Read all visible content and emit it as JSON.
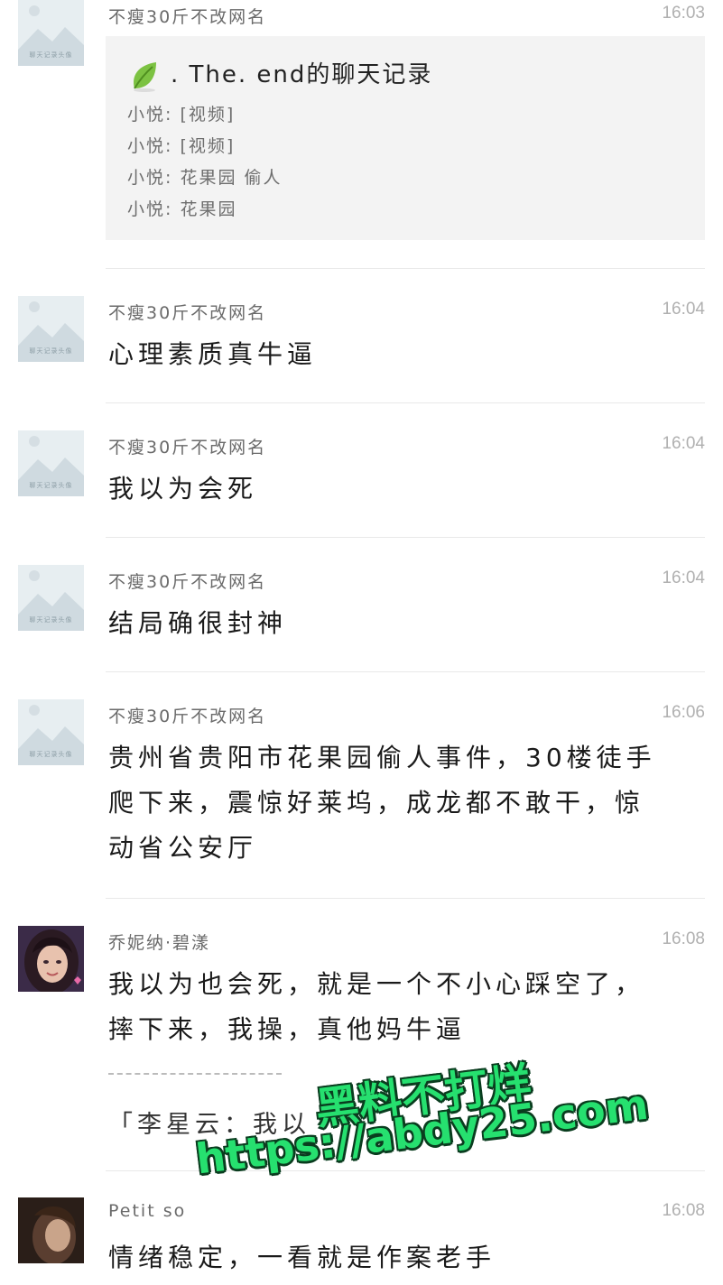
{
  "messages": [
    {
      "sender": "不瘦30斤不改网名",
      "time": "16:03",
      "avatar_caption": "聊天记录头像",
      "card": {
        "title": ". The. end的聊天记录",
        "lines": [
          "小悦: [视频]",
          "小悦: [视频]",
          "小悦: 花果园 偷人",
          "小悦: 花果园"
        ]
      }
    },
    {
      "sender": "不瘦30斤不改网名",
      "time": "16:04",
      "avatar_caption": "聊天记录头像",
      "text": "心理素质真牛逼"
    },
    {
      "sender": "不瘦30斤不改网名",
      "time": "16:04",
      "avatar_caption": "聊天记录头像",
      "text": "我以为会死"
    },
    {
      "sender": "不瘦30斤不改网名",
      "time": "16:04",
      "avatar_caption": "聊天记录头像",
      "text": "结局确很封神"
    },
    {
      "sender": "不瘦30斤不改网名",
      "time": "16:06",
      "avatar_caption": "聊天记录头像",
      "lines": [
        "贵州省贵阳市花果园偷人事件，30楼徒手",
        "爬下来，震惊好莱坞，成龙都不敢干，惊",
        "动省公安厅"
      ]
    },
    {
      "sender": "乔妮纳·碧漾",
      "time": "16:08",
      "lines": [
        "我以为也会死，就是一个不小心踩空了，",
        "摔下来，我操，真他妈牛逼"
      ],
      "quote": "「李星云：我以"
    },
    {
      "sender": "Petit so",
      "time": "16:08",
      "text": "情绪稳定，一看就是作案老手"
    }
  ],
  "watermark": {
    "line1": "黑料不打烊",
    "line2": "https://abdy25.com"
  },
  "colors": {
    "background": "#ffffff",
    "card": "#f3f3f3",
    "watermark": "#26e06f"
  },
  "icons": [
    "leaf-icon",
    "avatar-placeholder",
    "photo-avatar"
  ]
}
